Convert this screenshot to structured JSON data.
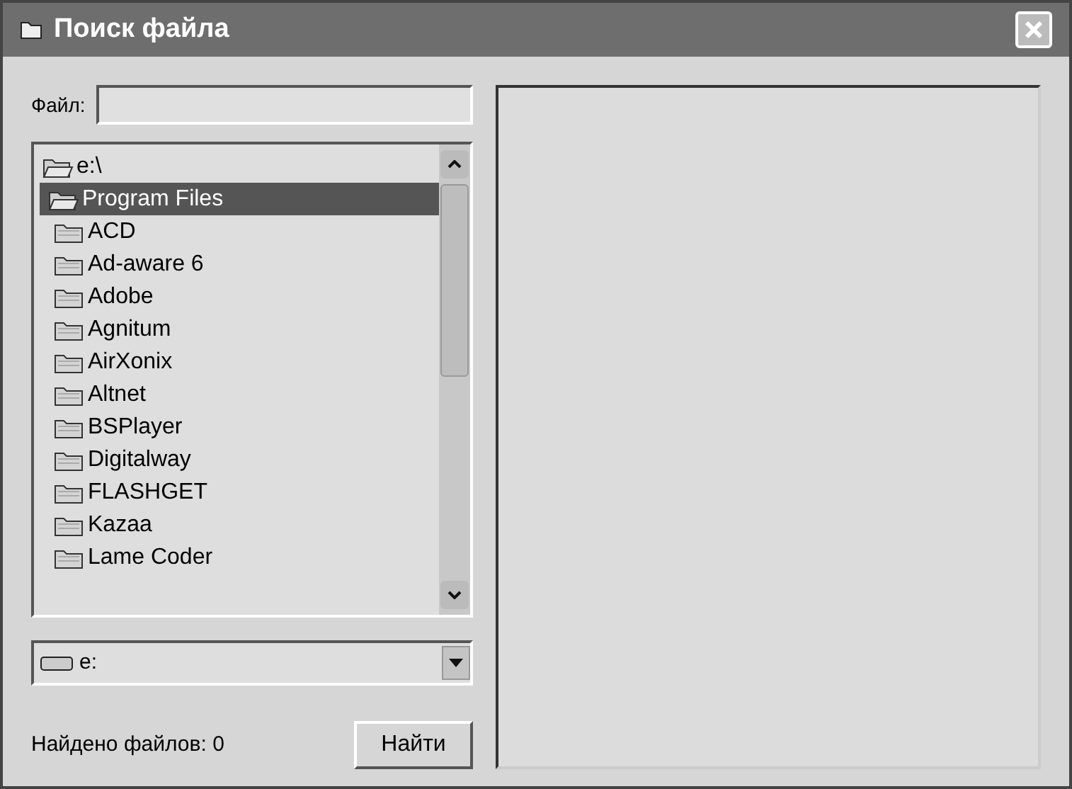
{
  "window": {
    "title": "Поиск файла"
  },
  "file_field": {
    "label": "Файл:"
  },
  "folders": [
    {
      "name": "e:\\",
      "kind": "drive-folder",
      "selected": false,
      "children": [
        {
          "name": "Program Files",
          "kind": "open-folder",
          "selected": true,
          "children": [
            {
              "name": "ACD",
              "kind": "folder",
              "selected": false
            },
            {
              "name": "Ad-aware 6",
              "kind": "folder",
              "selected": false
            },
            {
              "name": "Adobe",
              "kind": "folder",
              "selected": false
            },
            {
              "name": "Agnitum",
              "kind": "folder",
              "selected": false
            },
            {
              "name": "AirXonix",
              "kind": "folder",
              "selected": false
            },
            {
              "name": "Altnet",
              "kind": "folder",
              "selected": false
            },
            {
              "name": "BSPlayer",
              "kind": "folder",
              "selected": false
            },
            {
              "name": "Digitalway",
              "kind": "folder",
              "selected": false
            },
            {
              "name": "FLASHGET",
              "kind": "folder",
              "selected": false
            },
            {
              "name": "Kazaa",
              "kind": "folder",
              "selected": false
            },
            {
              "name": "Lame Coder",
              "kind": "folder",
              "selected": false
            }
          ]
        }
      ]
    }
  ],
  "drive": {
    "value": "e:"
  },
  "status": "Найдено файлов: 0",
  "buttons": [
    "Найти"
  ]
}
